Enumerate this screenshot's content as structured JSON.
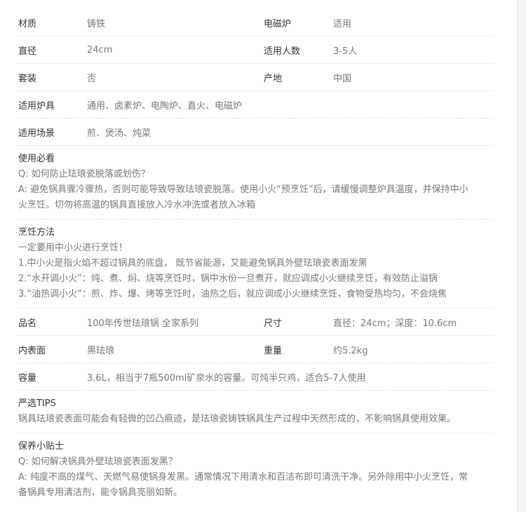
{
  "specs_top": [
    {
      "label": "材质",
      "value": "铸铁",
      "label2": "电磁炉",
      "value2": "适用"
    },
    {
      "label": "直径",
      "value": "24cm",
      "label2": "适用人数",
      "value2": "3-5人"
    },
    {
      "label": "套装",
      "value": "否",
      "label2": "产地",
      "value2": "中国"
    },
    {
      "label": "适用炉具",
      "value": "通用、卤素炉、电陶炉、直火、电磁炉"
    },
    {
      "label": "适用场景",
      "value": "煎、煲汤、炖菜"
    }
  ],
  "usage_notes": {
    "title": "使用必看",
    "question": "Q: 如何防止珐琅瓷脱落或划伤？",
    "answer": "A: 避免锅具骤冷骤热，否则可能导致导致珐琅瓷脱落。使用小火“预烹饪”后，请缓慢调整炉具温度，并保持中小火烹饪。切勿将高温的锅具直接放入冷水冲洗或者放入冰箱"
  },
  "cooking_method": {
    "title": "烹饪方法",
    "lines": [
      "一定要用中小火进行烹饪！",
      "1.中小火是指火焰不超过锅具的底盘， 既节省能源，又能避免锅具外壁珐琅瓷表面发黑",
      "2.“水开调小火”：炖、煮、焖、烧等烹饪时，锅中水份一旦煮开，就应调成小火继续烹饪，有效防止溢锅",
      "3.“油热调小火”：煎、炸、爆、烤等烹饪时，油热之后，就应调成小火继续烹饪，食物受热均匀，不会烧焦"
    ]
  },
  "specs_bottom": [
    {
      "label": "品名",
      "value": "100年传世珐琅锅 全家系列",
      "label2": "尺寸",
      "value2": "直径：24cm；深度：10.6cm"
    },
    {
      "label": "内表面",
      "value": "黑珐琅",
      "label2": "重量",
      "value2": "约5.2kg"
    },
    {
      "label": "容量",
      "value": "3.6L，相当于7瓶500ml矿泉水的容量。可炖半只鸡，适合5-7人使用"
    }
  ],
  "tips": {
    "title": "严选TIPS",
    "text": "锅具珐琅瓷表面可能会有轻微的凹凸痕迹，是珐琅瓷铸铁锅具生产过程中天然形成的，不影响锅具使用效果。"
  },
  "care": {
    "title": "保养小贴士",
    "question": "Q: 如何解决锅具外壁珐琅瓷表面发黑？",
    "answer": "A: 纯度不高的煤气、天燃气易使锅身发黑。通常情况下用清水和百洁布即可清洗干净。另外除用中小火烹饪，常备锅具专用清洁剂，能令锅具亮丽如新。"
  }
}
